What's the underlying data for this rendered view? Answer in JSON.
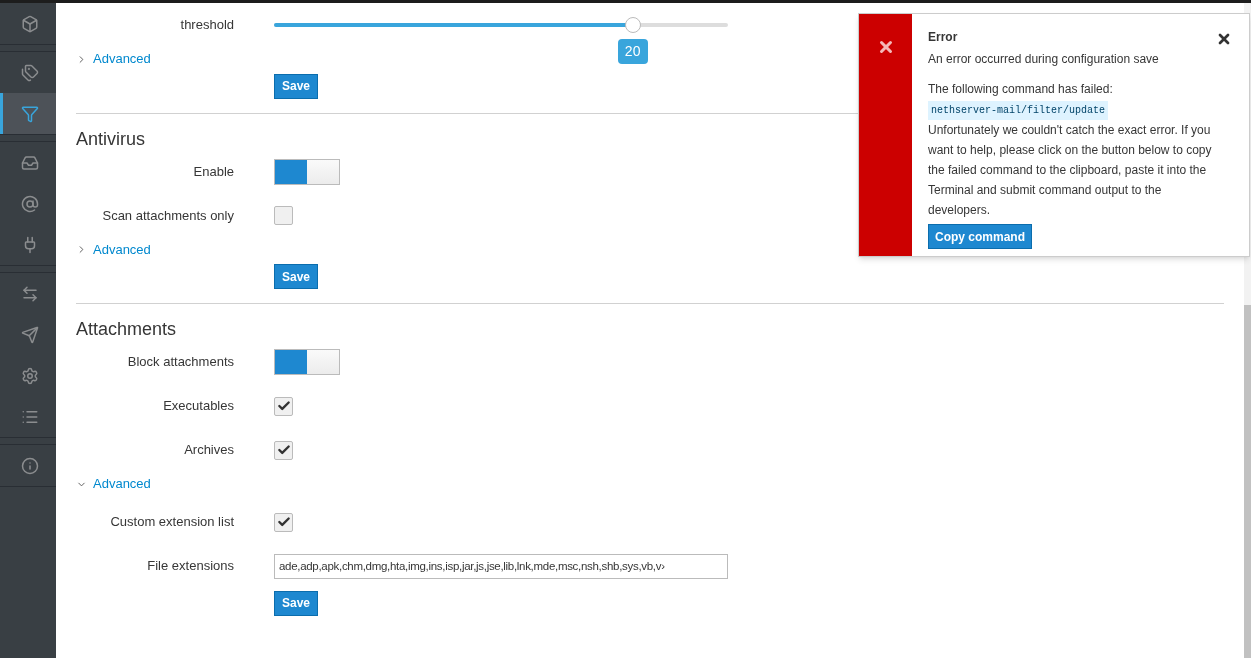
{
  "sidebar": {
    "groups": [
      {
        "items": [
          {
            "selected": false
          }
        ]
      },
      {
        "items": [
          {
            "selected": false
          },
          {
            "selected": true
          }
        ]
      },
      {
        "items": [
          {
            "selected": false
          },
          {
            "selected": false
          },
          {
            "selected": false
          }
        ]
      },
      {
        "items": [
          {
            "selected": false
          },
          {
            "selected": false
          },
          {
            "selected": false
          },
          {
            "selected": false
          }
        ]
      },
      {
        "items": [
          {
            "selected": false
          }
        ]
      }
    ]
  },
  "sections": [
    {
      "fields": [
        {
          "kind": "slider",
          "label": "threshold",
          "level": 0.79,
          "reading": "20"
        }
      ],
      "advanced": {
        "label": "Advanced",
        "expanded": false
      },
      "save": "Save"
    },
    {
      "title": "Antivirus",
      "fields": [
        {
          "kind": "toggle",
          "label": "Enable",
          "on": true
        },
        {
          "kind": "checkbox",
          "label": "Scan attachments only",
          "checked": false
        }
      ],
      "advanced": {
        "label": "Advanced",
        "expanded": false
      },
      "save": "Save"
    },
    {
      "title": "Attachments",
      "fields": [
        {
          "kind": "toggle",
          "label": "Block attachments",
          "on": true
        },
        {
          "kind": "checkbox",
          "label": "Executables",
          "checked": true
        },
        {
          "kind": "checkbox",
          "label": "Archives",
          "checked": true
        }
      ],
      "advanced": {
        "label": "Advanced",
        "expanded": true,
        "fields": [
          {
            "kind": "checkbox",
            "label": "Custom extension list",
            "checked": true
          },
          {
            "kind": "text",
            "label": "File extensions",
            "value": "ade,adp,apk,chm,dmg,hta,img,ins,isp,jar,js,jse,lib,lnk,mde,msc,nsh,shb,sys,vb,v›"
          }
        ]
      },
      "save": "Save"
    }
  ],
  "toast": {
    "title": "Error",
    "subtitle": "An error occurred during configuration save",
    "intro": "The following command has failed:",
    "command": "nethserver-mail/filter/update",
    "body": "Unfortunately we couldn't catch the exact error. If you want to help, please click on the button below to copy the failed command to the clipboard, paste it into the Terminal and submit command output to the developers.",
    "button": "Copy command"
  }
}
